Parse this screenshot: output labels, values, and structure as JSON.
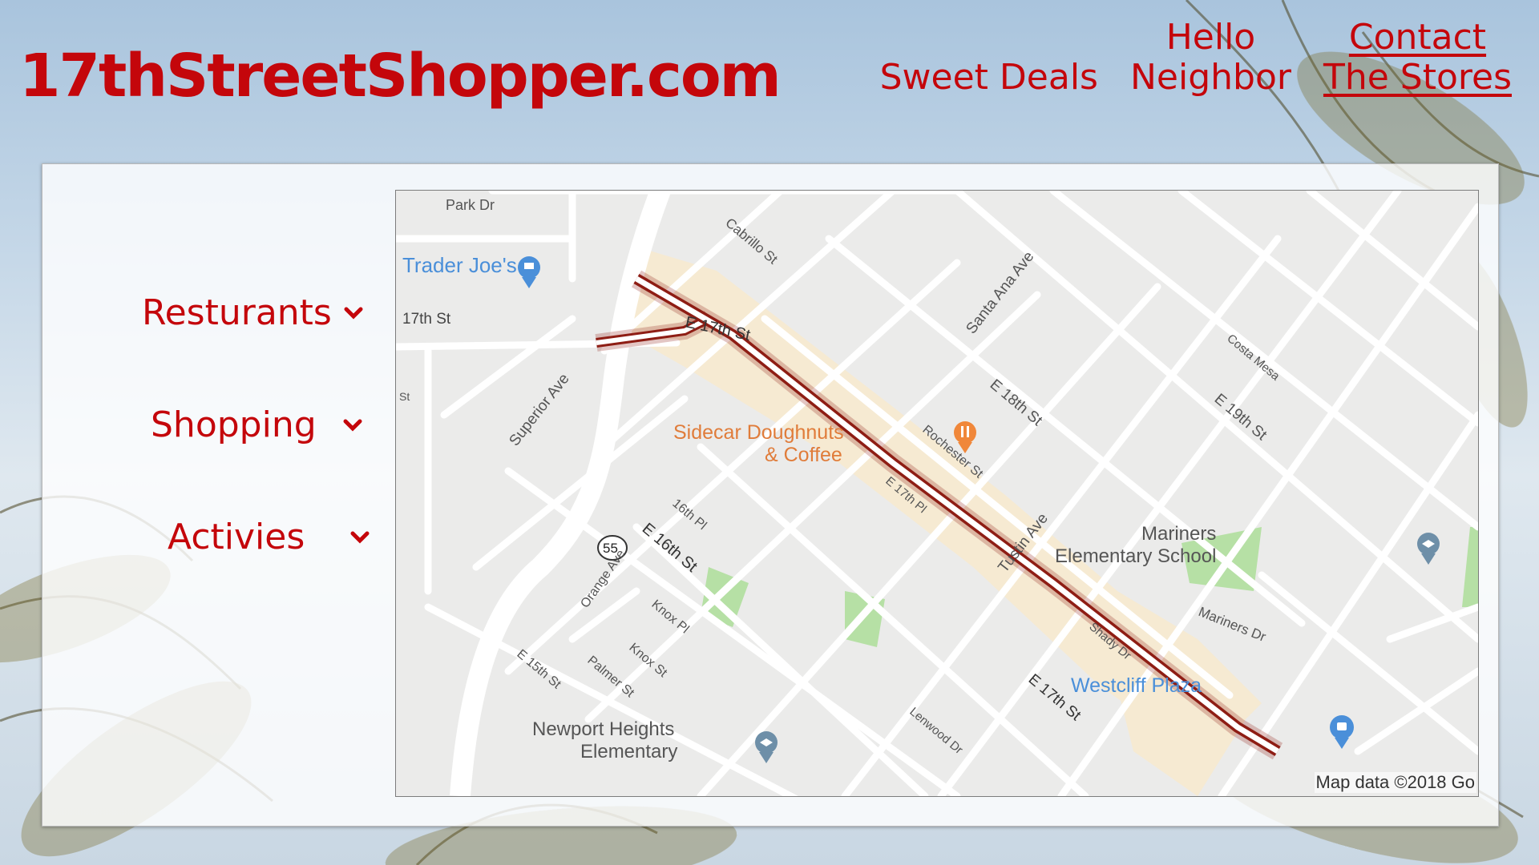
{
  "site": {
    "logo": "17thStreetShopper.com"
  },
  "nav": {
    "sweet_deals": "Sweet Deals",
    "hello_neighbor_line1": "Hello",
    "hello_neighbor_line2": "Neighbor",
    "contact_line1": "Contact",
    "contact_line2": "The Stores"
  },
  "menu": {
    "items": [
      {
        "label": "Resturants",
        "icon": "chevron-down-icon"
      },
      {
        "label": "Shopping",
        "icon": "chevron-down-icon"
      },
      {
        "label": "Activies",
        "icon": "chevron-down-icon"
      }
    ]
  },
  "map": {
    "labels": {
      "park_dr": "Park Dr",
      "trader_joes": "Trader Joe's",
      "seventeenth_st": "17th St",
      "e17th_st": "E 17th St",
      "cabrillo_st": "Cabrillo St",
      "superior_ave": "Superior Ave",
      "st": "St",
      "santa_ana_ave": "Santa Ana Ave",
      "e18th_st": "E 18th St",
      "e19th_st": "E 19th St",
      "costa_mesa": "Costa Mesa",
      "sidecar_line1": "Sidecar Doughnuts",
      "sidecar_line2": "& Coffee",
      "rochester_st": "Rochester St",
      "e17th_pl": "E 17th Pl",
      "sixteenth_pl": "16th Pl",
      "route_55": "55",
      "orange_ave": "Orange Ave",
      "e16th_st": "E 16th St",
      "knox_pl": "Knox Pl",
      "tustin_ave": "Tustin Ave",
      "mariners_line1": "Mariners",
      "mariners_line2": "Elementary School",
      "shady_dr": "Shady Dr",
      "mariners_dr": "Mariners Dr",
      "e15th_st": "E 15th St",
      "knox_st": "Knox St",
      "palmer_st": "Palmer St",
      "westcliff_plaza": "Westcliff Plaza",
      "e17th_st_lower": "E 17th St",
      "lenwood_dr": "Lenwood Dr",
      "newport_line1": "Newport Heights",
      "newport_line2": "Elementary"
    },
    "copyright": "Map data ©2018 Go"
  },
  "colors": {
    "brand_red": "#c4060b",
    "route_red": "#8e1d14",
    "map_bg": "#ebebea",
    "road": "#ffffff",
    "park_green": "#b6e0a5",
    "commercial": "#f6ead2",
    "poi_blue": "#4a8fd9",
    "poi_orange": "#f0873a"
  }
}
